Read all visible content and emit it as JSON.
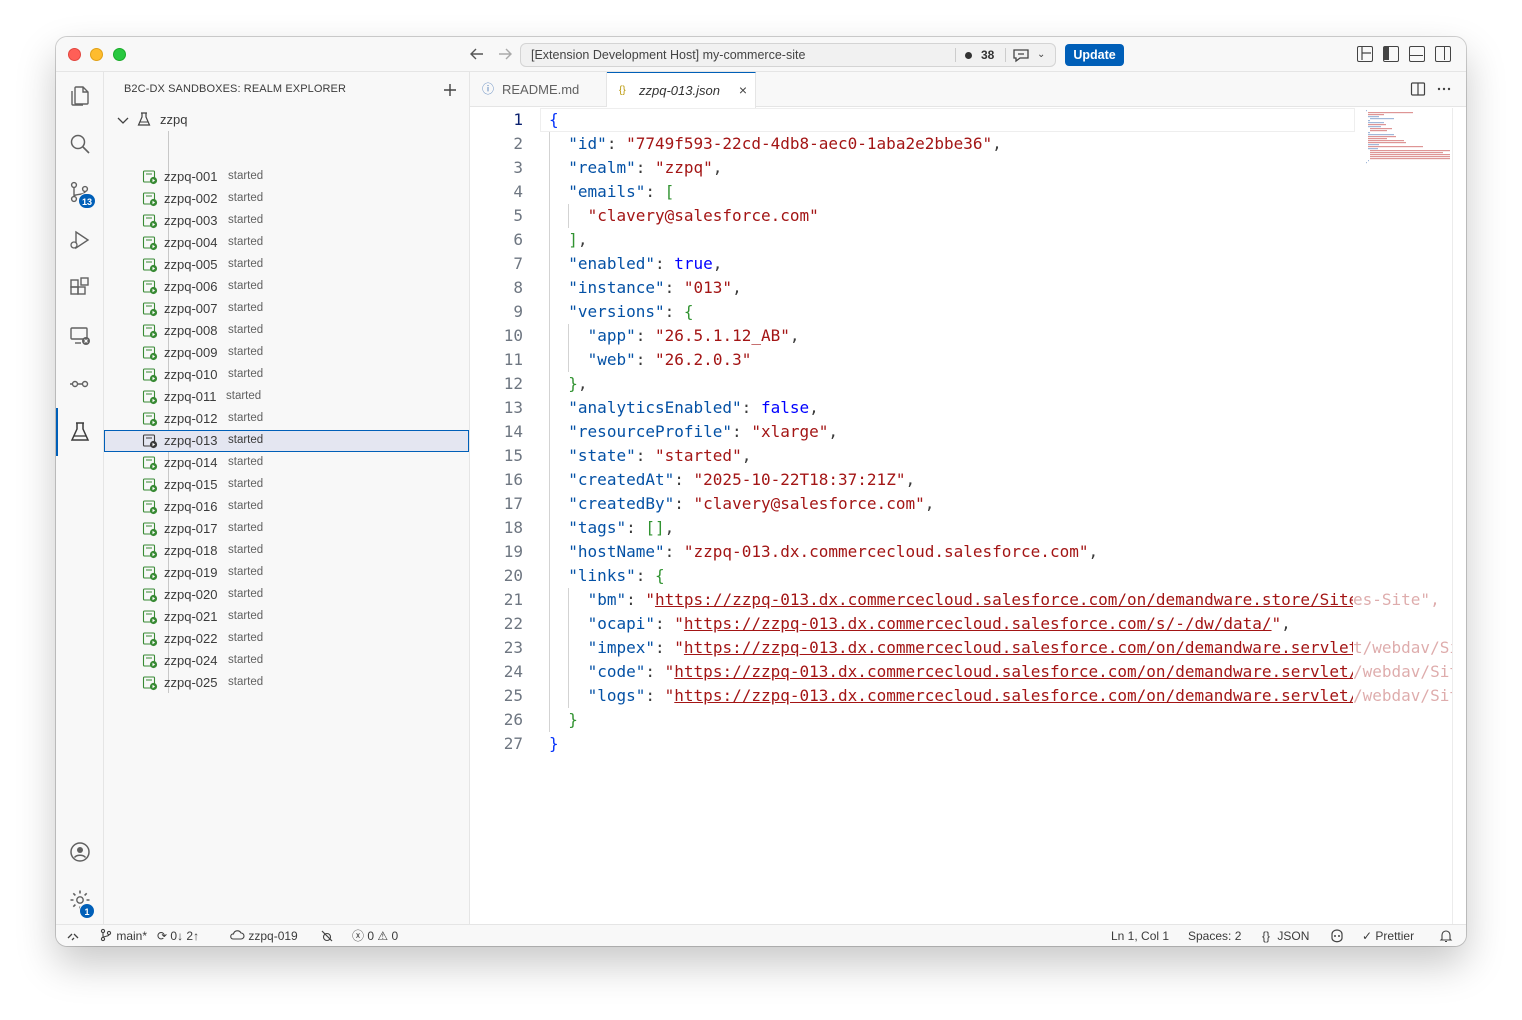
{
  "titlebar": {
    "command_center": "[Extension Development Host] my-commerce-site",
    "notification_count": "38",
    "update_label": "Update"
  },
  "activity": {
    "scm_badge": "13",
    "settings_badge": "1"
  },
  "sidebar": {
    "title": "B2C-DX SANDBOXES: REALM EXPLORER",
    "root_label": "zzpq",
    "items": [
      {
        "name": "zzpq-001",
        "status": "started"
      },
      {
        "name": "zzpq-002",
        "status": "started"
      },
      {
        "name": "zzpq-003",
        "status": "started"
      },
      {
        "name": "zzpq-004",
        "status": "started"
      },
      {
        "name": "zzpq-005",
        "status": "started"
      },
      {
        "name": "zzpq-006",
        "status": "started"
      },
      {
        "name": "zzpq-007",
        "status": "started"
      },
      {
        "name": "zzpq-008",
        "status": "started"
      },
      {
        "name": "zzpq-009",
        "status": "started"
      },
      {
        "name": "zzpq-010",
        "status": "started"
      },
      {
        "name": "zzpq-011",
        "status": "started"
      },
      {
        "name": "zzpq-012",
        "status": "started"
      },
      {
        "name": "zzpq-013",
        "status": "started"
      },
      {
        "name": "zzpq-014",
        "status": "started"
      },
      {
        "name": "zzpq-015",
        "status": "started"
      },
      {
        "name": "zzpq-016",
        "status": "started"
      },
      {
        "name": "zzpq-017",
        "status": "started"
      },
      {
        "name": "zzpq-018",
        "status": "started"
      },
      {
        "name": "zzpq-019",
        "status": "started"
      },
      {
        "name": "zzpq-020",
        "status": "started"
      },
      {
        "name": "zzpq-021",
        "status": "started"
      },
      {
        "name": "zzpq-022",
        "status": "started"
      },
      {
        "name": "zzpq-024",
        "status": "started"
      },
      {
        "name": "zzpq-025",
        "status": "started"
      }
    ],
    "selected_index": 12
  },
  "tabs": [
    {
      "icon": "ⓘ",
      "label": "README.md"
    },
    {
      "icon": "{}",
      "label": "zzpq-013.json",
      "close": "×"
    }
  ],
  "code": {
    "current_line": 1,
    "lines": [
      "{",
      "  \"id\": \"7749f593-22cd-4db8-aec0-1aba2e2bbe36\",",
      "  \"realm\": \"zzpq\",",
      "  \"emails\": [",
      "    \"clavery@salesforce.com\"",
      "  ],",
      "  \"enabled\": true,",
      "  \"instance\": \"013\",",
      "  \"versions\": {",
      "    \"app\": \"26.5.1.12_AB\",",
      "    \"web\": \"26.2.0.3\"",
      "  },",
      "  \"analyticsEnabled\": false,",
      "  \"resourceProfile\": \"xlarge\",",
      "  \"state\": \"started\",",
      "  \"createdAt\": \"2025-10-22T18:37:21Z\",",
      "  \"createdBy\": \"clavery@salesforce.com\",",
      "  \"tags\": [],",
      "  \"hostName\": \"zzpq-013.dx.commercecloud.salesforce.com\",",
      "  \"links\": {",
      "    \"bm\": \"https://zzpq-013.dx.commercecloud.salesforce.com/on/demandware.store/Sites-Site\",",
      "    \"ocapi\": \"https://zzpq-013.dx.commercecloud.salesforce.com/s/-/dw/data/\",",
      "    \"impex\": \"https://zzpq-013.dx.commercecloud.salesforce.com/on/demandware.servlet/webdav/Si",
      "    \"code\": \"https://zzpq-013.dx.commercecloud.salesforce.com/on/demandware.servlet/webdav/Sit",
      "    \"logs\": \"https://zzpq-013.dx.commercecloud.salesforce.com/on/demandware.servlet/webdav/Sit",
      "  }",
      "}"
    ]
  },
  "statusbar": {
    "branch": "main*",
    "sync": "0↓ 2↑",
    "sandbox": "zzpq-019",
    "errors": "0",
    "warnings": "0",
    "cursor": "Ln 1, Col 1",
    "spaces": "Spaces: 2",
    "language": "JSON",
    "formatter": "Prettier"
  },
  "colors": {
    "accent": "#005fb8",
    "json_key": "#0451a5",
    "json_string": "#a31515",
    "json_literal": "#0000ff",
    "started_icon": "#388a34"
  }
}
